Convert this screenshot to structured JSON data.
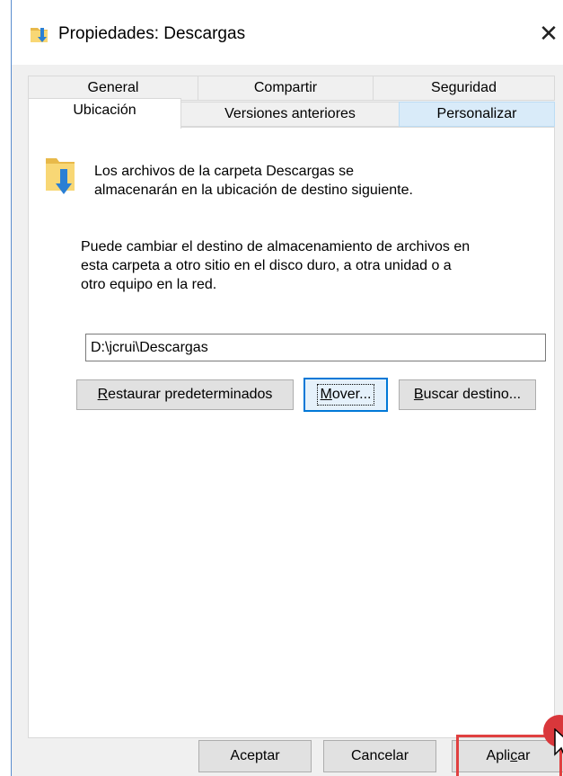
{
  "window": {
    "title": "Propiedades: Descargas",
    "close_glyph": "✕"
  },
  "tabs": {
    "row1": [
      "General",
      "Compartir",
      "Seguridad"
    ],
    "row2": [
      "Ubicación",
      "Versiones anteriores",
      "Personalizar"
    ],
    "active": "Ubicación",
    "hovered": "Personalizar"
  },
  "content": {
    "info_line1": "Los archivos de la carpeta Descargas se",
    "info_line2": "almacenarán en la ubicación de destino siguiente.",
    "desc_line1": "Puede cambiar el destino de almacenamiento de archivos en",
    "desc_line2": "esta carpeta a otro sitio en el disco duro, a otra unidad o a",
    "desc_line3": "otro equipo en la red.",
    "path_value": "D:\\jcrui\\Descargas",
    "restore_first": "R",
    "restore_rest": "estaurar predeterminados",
    "move_first": "M",
    "move_rest": "over...",
    "find_first": "B",
    "find_rest": "uscar destino..."
  },
  "footer": {
    "ok_label": "Aceptar",
    "cancel_label": "Cancelar",
    "apply_before": "Apli",
    "apply_underlined": "c",
    "apply_after": "ar"
  },
  "icons": {
    "title_icon": "folder-download-icon",
    "info_icon": "folder-download-icon",
    "cursor": "mouse-pointer-icon"
  },
  "colors": {
    "accent": "#0078d7",
    "highlight": "#e04040",
    "folder": "#f8d775",
    "arrow": "#2a7fd4",
    "tab_hover": "#d9ebf9"
  }
}
